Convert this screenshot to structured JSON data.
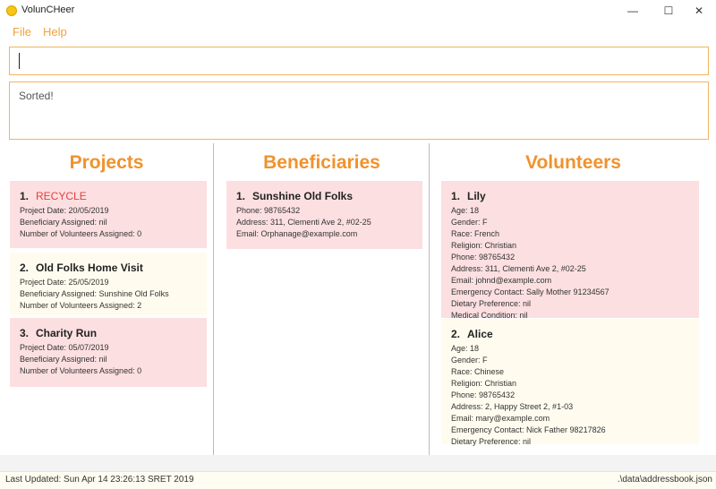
{
  "window": {
    "title": "VolunCHeer",
    "minimize": "—",
    "maximize": "☐",
    "close": "✕"
  },
  "menu": {
    "file": "File",
    "help": "Help"
  },
  "command": {
    "value": ""
  },
  "result": {
    "text": "Sorted!"
  },
  "colors": {
    "accent": "#f0922e",
    "card_highlight": "#fcdfe1",
    "card_plain": "#fffcef",
    "alert": "#e24040"
  },
  "projects": {
    "title": "Projects",
    "items": [
      {
        "index": "1.",
        "name": "RECYCLE",
        "date": "Project Date: 20/05/2019",
        "beneficiary": "Beneficiary Assigned: nil",
        "volunteers": "Number of Volunteers Assigned: 0"
      },
      {
        "index": "2.",
        "name": "Old Folks Home Visit",
        "date": "Project Date: 25/05/2019",
        "beneficiary": "Beneficiary Assigned: Sunshine Old Folks",
        "volunteers": "Number of Volunteers Assigned: 2"
      },
      {
        "index": "3.",
        "name": "Charity Run",
        "date": "Project Date: 05/07/2019",
        "beneficiary": "Beneficiary Assigned: nil",
        "volunteers": "Number of Volunteers Assigned: 0"
      }
    ]
  },
  "beneficiaries": {
    "title": "Beneficiaries",
    "items": [
      {
        "index": "1.",
        "name": "Sunshine Old Folks",
        "phone": "Phone: 98765432",
        "address": "Address: 311, Clementi Ave 2, #02-25",
        "email": "Email: Orphanage@example.com"
      }
    ]
  },
  "volunteers": {
    "title": "Volunteers",
    "items": [
      {
        "index": "1.",
        "name": "Lily",
        "age": "Age: 18",
        "gender": "Gender: F",
        "race": "Race: French",
        "religion": "Religion: Christian",
        "phone": "Phone: 98765432",
        "address": "Address: 311, Clementi Ave 2, #02-25",
        "email": "Email: johnd@example.com",
        "emergency": "Emergency Contact: Sally Mother 91234567",
        "dietary": "Dietary Preference: nil",
        "medical": "Medical Condition: nil"
      },
      {
        "index": "2.",
        "name": "Alice",
        "age": "Age: 18",
        "gender": "Gender: F",
        "race": "Race: Chinese",
        "religion": "Religion: Christian",
        "phone": "Phone: 98765432",
        "address": "Address: 2, Happy Street 2, #1-03",
        "email": "Email: mary@example.com",
        "emergency": "Emergency Contact: Nick Father 98217826",
        "dietary": "Dietary Preference: nil"
      }
    ]
  },
  "footer": {
    "last_updated": "Last Updated: Sun Apr 14 23:26:13 SRET 2019",
    "path": ".\\data\\addressbook.json"
  }
}
